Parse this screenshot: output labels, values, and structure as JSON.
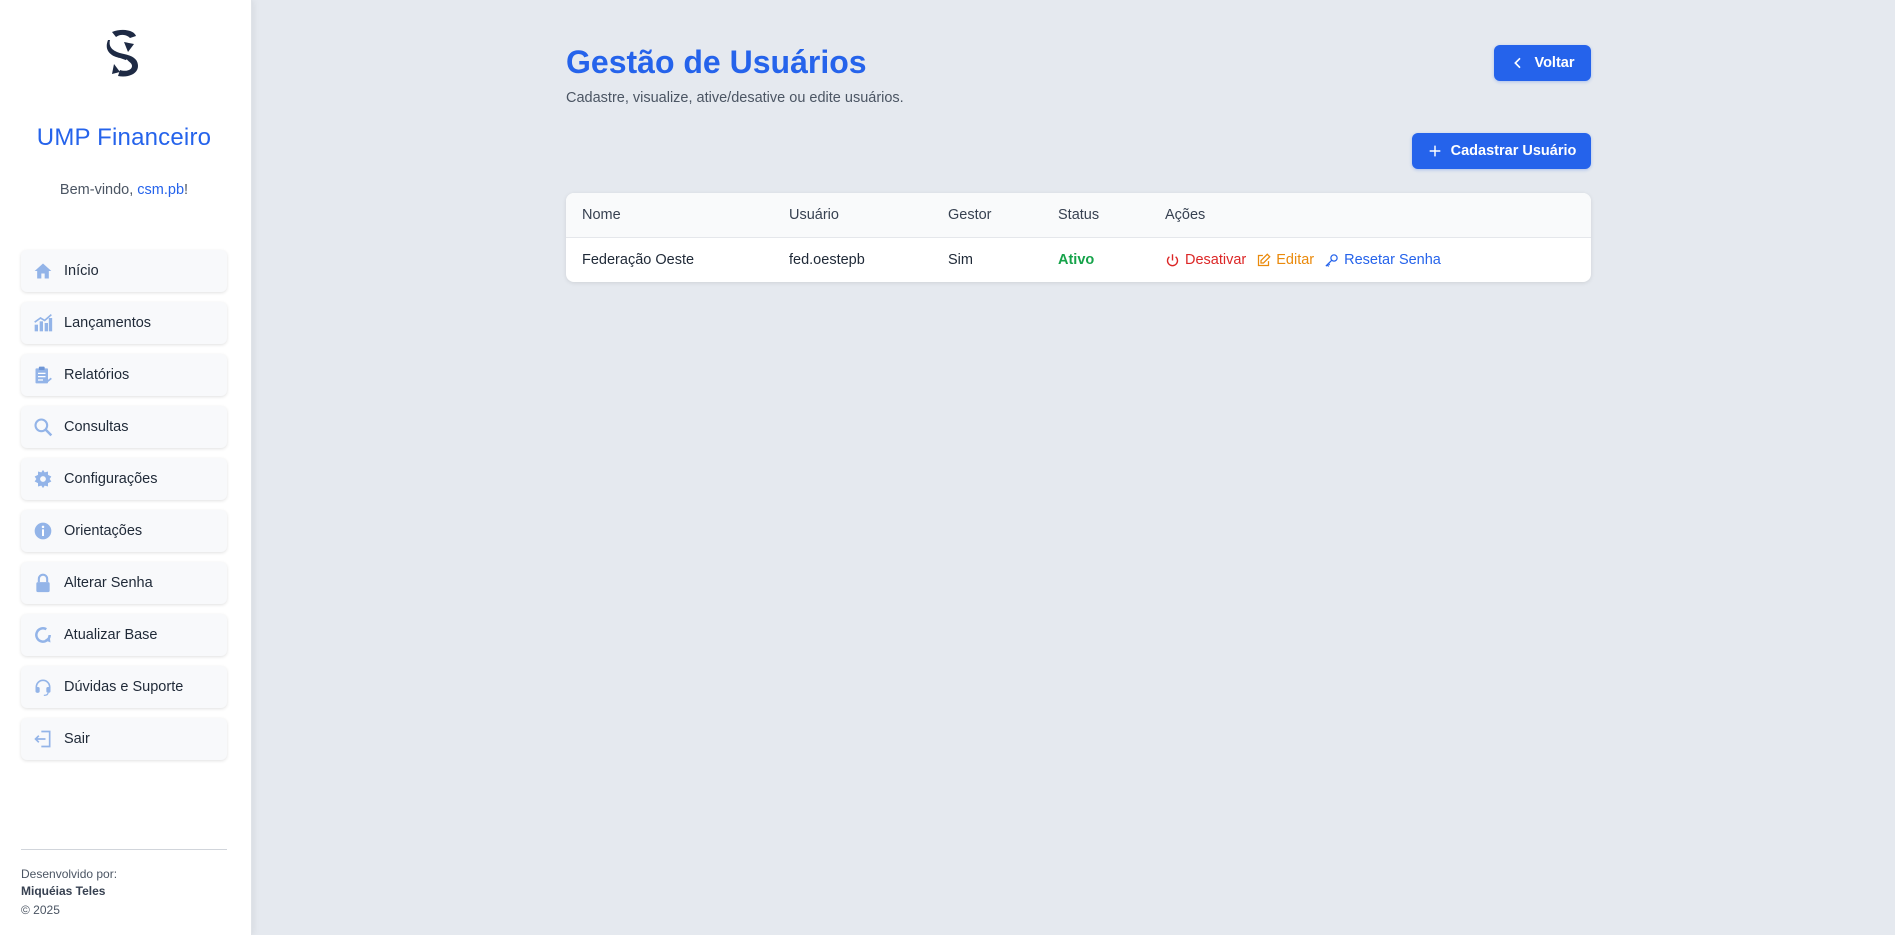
{
  "sidebar": {
    "title": "UMP Financeiro",
    "welcome_prefix": "Bem-vindo, ",
    "welcome_user": "csm.pb",
    "welcome_suffix": "!",
    "items": [
      {
        "label": "Início",
        "icon": "home-icon"
      },
      {
        "label": "Lançamentos",
        "icon": "bar-chart-icon"
      },
      {
        "label": "Relatórios",
        "icon": "clipboard-icon"
      },
      {
        "label": "Consultas",
        "icon": "search-icon"
      },
      {
        "label": "Configurações",
        "icon": "gear-icon"
      },
      {
        "label": "Orientações",
        "icon": "info-icon"
      },
      {
        "label": "Alterar Senha",
        "icon": "lock-icon"
      },
      {
        "label": "Atualizar Base",
        "icon": "refresh-icon"
      },
      {
        "label": "Dúvidas e Suporte",
        "icon": "headset-icon"
      },
      {
        "label": "Sair",
        "icon": "logout-icon"
      }
    ],
    "footer": {
      "developed_by": "Desenvolvido por:",
      "developer": "Miquéias Teles",
      "copyright": "© 2025"
    }
  },
  "header": {
    "title": "Gestão de Usuários",
    "subtitle": "Cadastre, visualize, ative/desative ou edite usuários.",
    "back_label": "Voltar",
    "add_label": "Cadastrar Usuário"
  },
  "table": {
    "columns": [
      "Nome",
      "Usuário",
      "Gestor",
      "Status",
      "Ações"
    ],
    "rows": [
      {
        "nome": "Federação Oeste",
        "usuario": "fed.oestepb",
        "gestor": "Sim",
        "status": "Ativo",
        "actions": {
          "deactivate": "Desativar",
          "edit": "Editar",
          "reset": "Resetar Senha"
        }
      }
    ]
  },
  "colors": {
    "accent": "#2563eb",
    "active": "#16a34a",
    "danger": "#dc2626",
    "warning": "#ea8a0c",
    "background": "#e5e9ef",
    "icon": "#93b4e8"
  }
}
